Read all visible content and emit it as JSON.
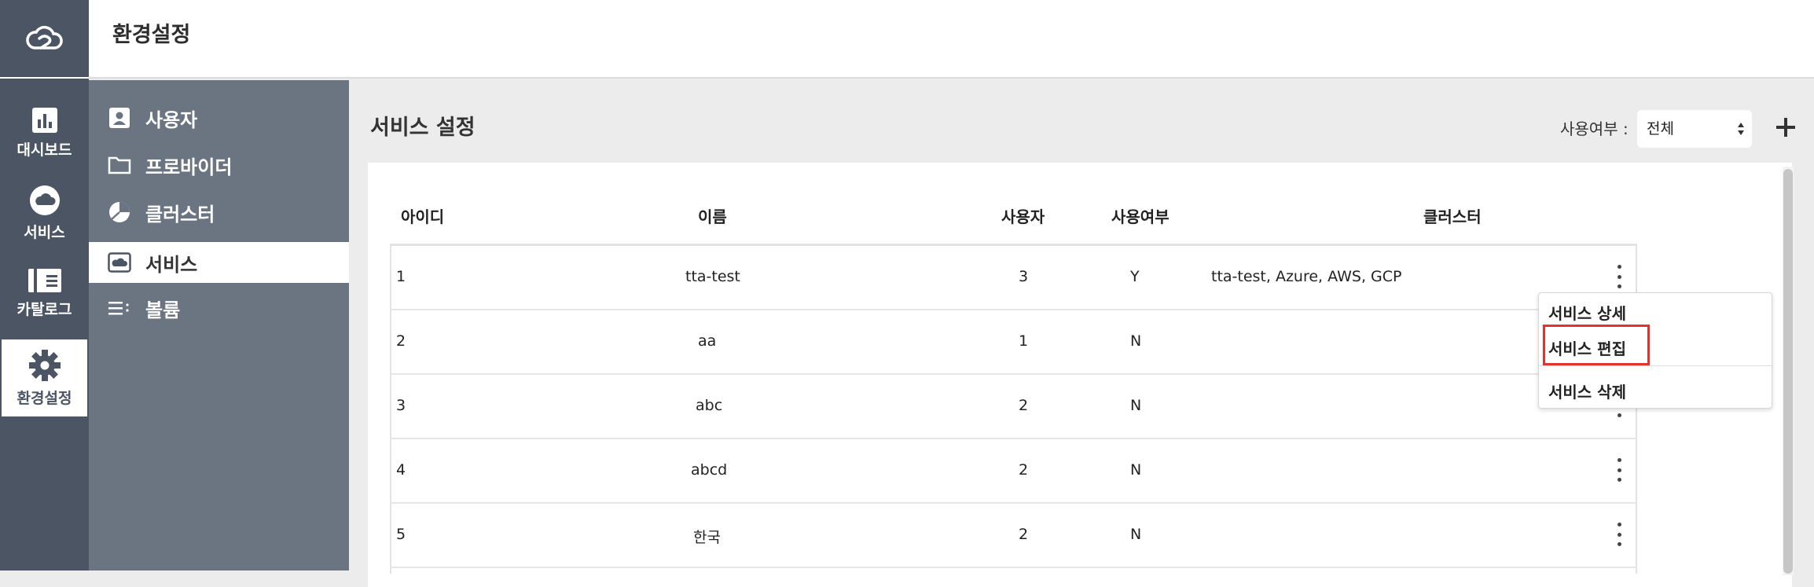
{
  "header": {
    "title": "환경설정"
  },
  "rail": {
    "items": [
      {
        "label": "대시보드",
        "icon": "bar-chart-icon"
      },
      {
        "label": "서비스",
        "icon": "cloud-icon"
      },
      {
        "label": "카탈로그",
        "icon": "book-icon"
      },
      {
        "label": "환경설정",
        "icon": "gear-icon"
      }
    ],
    "active": "환경설정"
  },
  "subnav": {
    "items": [
      {
        "label": "사용자",
        "icon": "user-icon"
      },
      {
        "label": "프로바이더",
        "icon": "folder-icon"
      },
      {
        "label": "클러스터",
        "icon": "pie-icon"
      },
      {
        "label": "서비스",
        "icon": "cloud-box-icon"
      },
      {
        "label": "볼륨",
        "icon": "list-icon"
      }
    ],
    "active": "서비스"
  },
  "main": {
    "title": "서비스 설정",
    "filter": {
      "label": "사용여부 :",
      "value": "전체"
    },
    "add_label": "+"
  },
  "table": {
    "headers": [
      "아이디",
      "이름",
      "사용자",
      "사용여부",
      "클러스터"
    ],
    "rows": [
      {
        "id": "1",
        "name": "tta-test",
        "users": "3",
        "enabled": "Y",
        "clusters": "tta-test, Azure, AWS, GCP"
      },
      {
        "id": "2",
        "name": "aa",
        "users": "1",
        "enabled": "N",
        "clusters": ""
      },
      {
        "id": "3",
        "name": "abc",
        "users": "2",
        "enabled": "N",
        "clusters": ""
      },
      {
        "id": "4",
        "name": "abcd",
        "users": "2",
        "enabled": "N",
        "clusters": ""
      },
      {
        "id": "5",
        "name": "한국",
        "users": "2",
        "enabled": "N",
        "clusters": ""
      }
    ]
  },
  "context_menu": {
    "items": [
      "서비스 상세",
      "서비스 편집",
      "서비스 삭제"
    ],
    "highlighted": "서비스 편집",
    "highlight_color": "#e0332b"
  },
  "colors": {
    "rail_bg": "#4b5563",
    "subnav_bg": "#6b7581",
    "content_bg": "#ececec"
  }
}
